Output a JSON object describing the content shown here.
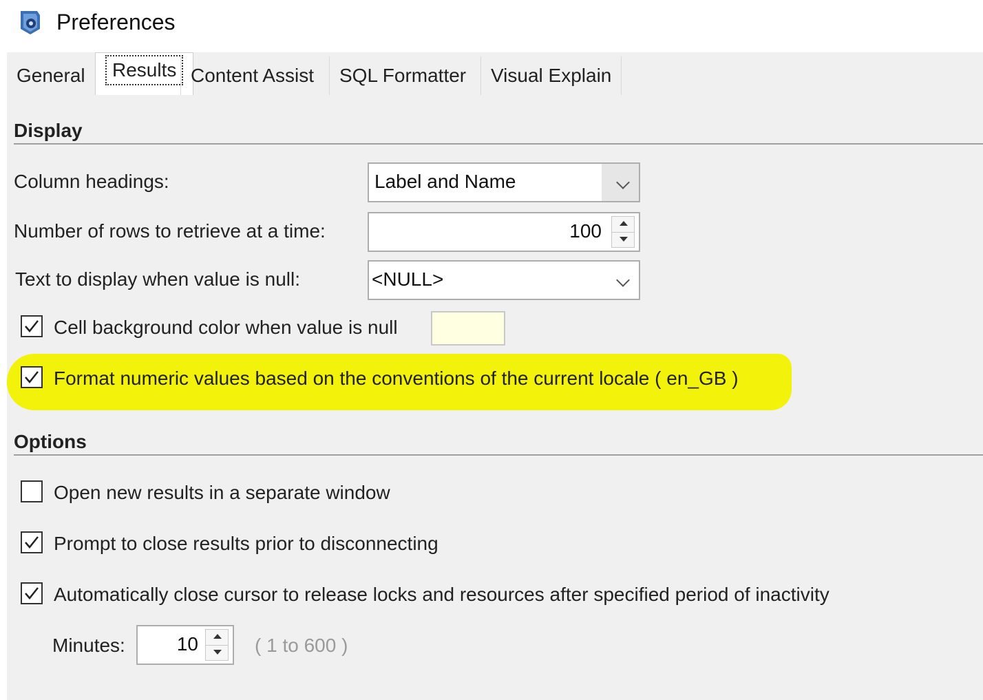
{
  "window": {
    "title": "Preferences",
    "icon": "preferences-app-icon"
  },
  "tabs": [
    {
      "label": "General",
      "active": false
    },
    {
      "label": "Results",
      "active": true
    },
    {
      "label": "Content Assist",
      "active": false
    },
    {
      "label": "SQL Formatter",
      "active": false
    },
    {
      "label": "Visual Explain",
      "active": false
    }
  ],
  "display": {
    "title": "Display",
    "column_headings": {
      "label": "Column headings:",
      "value": "Label and Name"
    },
    "rows": {
      "label": "Number of rows to retrieve at a time:",
      "value": "100"
    },
    "null_text": {
      "label": "Text to display when value is null:",
      "value": "<NULL>"
    },
    "cell_bg": {
      "label": "Cell background color when value is null",
      "checked": true,
      "color": "#ffffe1"
    },
    "format_numeric": {
      "label": "Format numeric values based on the conventions of the current locale ( en_GB )",
      "checked": true,
      "highlight_color": "#f2f20a"
    }
  },
  "options": {
    "title": "Options",
    "open_new": {
      "label": "Open new results in a separate window",
      "checked": false
    },
    "prompt_close": {
      "label": "Prompt to close results prior to disconnecting",
      "checked": true
    },
    "auto_close": {
      "label": "Automatically close cursor to release locks and resources after specified period of inactivity",
      "checked": true
    },
    "minutes": {
      "label": "Minutes:",
      "value": "10",
      "range_hint": "( 1 to 600 )"
    }
  }
}
